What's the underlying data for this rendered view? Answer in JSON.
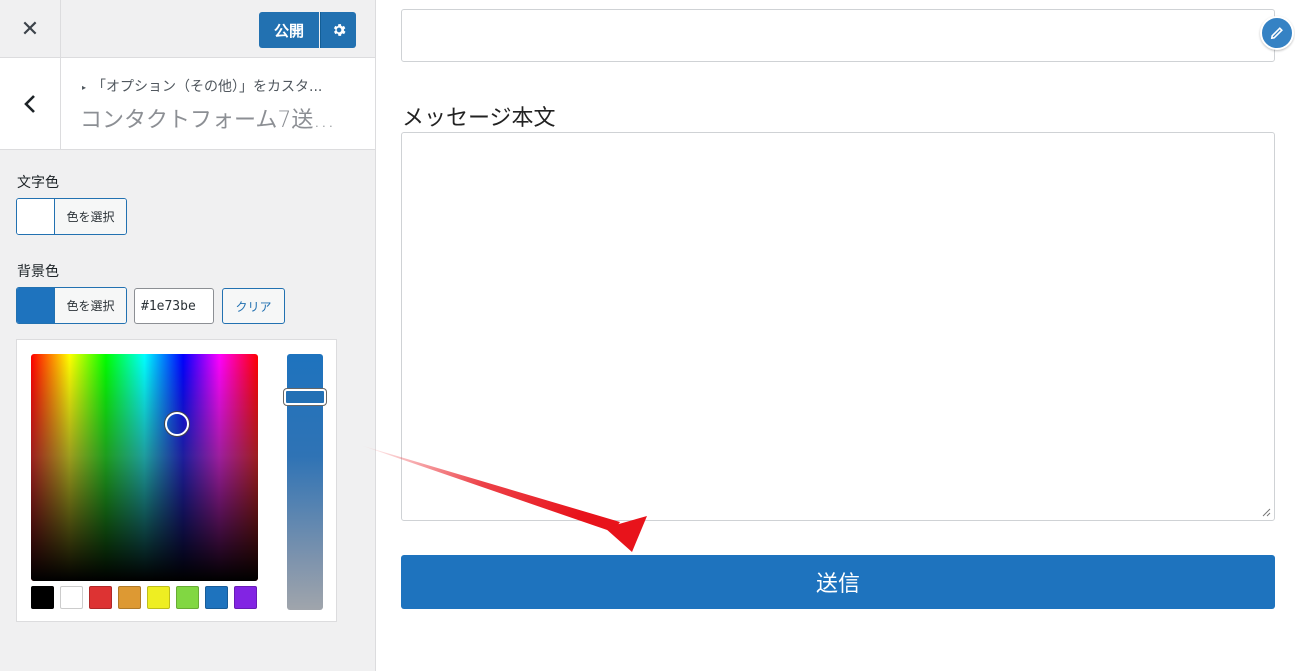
{
  "topbar": {
    "close_symbol": "✕",
    "publish_label": "公開",
    "settings_icon": "gear-icon"
  },
  "section": {
    "breadcrumb_marker": "▸",
    "breadcrumb": "「オプション（その他）」をカスタ...",
    "title": "コンタクトフォーム7送..."
  },
  "text_color": {
    "label": "文字色",
    "button_label": "色を選択",
    "swatch_color": "#ffffff"
  },
  "bg_color": {
    "label": "背景色",
    "button_label": "色を選択",
    "value": "#1e73be",
    "clear_label": "クリア",
    "swatch_color": "#1e73be"
  },
  "palette": [
    "#000000",
    "#ffffff",
    "#dd3333",
    "#dd9933",
    "#eeee22",
    "#81d742",
    "#1e73be",
    "#8224e3"
  ],
  "preview": {
    "message_label": "メッセージ本文",
    "submit_label": "送信",
    "edit_icon": "pencil-icon"
  },
  "colors": {
    "accent": "#2271b1",
    "submit": "#1e73be",
    "arrow": "#e8131b"
  }
}
